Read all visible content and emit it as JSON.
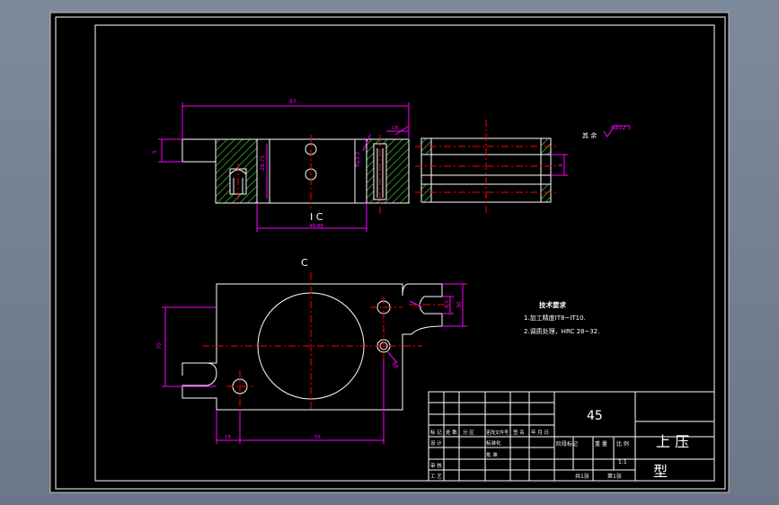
{
  "colors": {
    "background_outer": "#6e7a8b",
    "sheet": "#000000",
    "line": "#ffffff",
    "dimension": "#ff00ff",
    "centerline": "#ff0000",
    "hatch": "#2e8b2e"
  },
  "drawing": {
    "section_label_top": "C",
    "section_label_front": "C",
    "dims": {
      "overall_width": "97",
      "left_height": "5",
      "inner_height": "28.75",
      "bottom_width": "48.88",
      "slot_small": "18",
      "roughness_mid": "Ra3.2",
      "right_depth": "4",
      "slot_width": "8.3",
      "slot_height": "30",
      "plan_height": "70",
      "plan_left": "15",
      "plan_hole_span": "55",
      "hole_dim": "R8"
    },
    "roughness_note": {
      "prefix": "其 余",
      "value": "Ra12.5"
    },
    "tech_requirements": {
      "title": "技术要求",
      "line1": "1.加工精度IT8~IT10.",
      "line2": "2.调质处理，HRC 28~32."
    }
  },
  "title_block": {
    "material": "45",
    "part_name": "上 压",
    "part_name_2": "型",
    "row_labels": [
      "标 记",
      "处 数",
      "分 区",
      "更改文件号",
      "签 名",
      "年 月 日"
    ],
    "row_labels_2": [
      "设 计",
      "标准化",
      "审 核",
      "工 艺",
      "批 准"
    ],
    "stage_label": "阶段标记",
    "weight_label": "重 量",
    "scale_label": "比 例",
    "scale_value": "1:1",
    "sheets_total": "共1张",
    "sheet_index": "第1张"
  }
}
